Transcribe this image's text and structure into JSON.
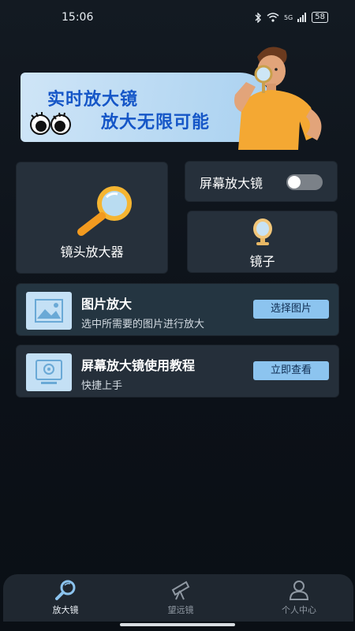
{
  "status_bar": {
    "time": "15:06",
    "bluetooth_icon": "bluetooth-icon",
    "wifi_icon": "wifi-icon",
    "signal_text": "5G",
    "battery": "58"
  },
  "banner": {
    "line1": "实时放大镜",
    "line2": "放大无限可能"
  },
  "cards": {
    "lens": {
      "label": "镜头放大器",
      "icon": "magnifier-icon"
    },
    "screen_magnifier": {
      "label": "屏幕放大镜",
      "toggle_on": false
    },
    "mirror": {
      "label": "镜子",
      "icon": "mirror-icon"
    }
  },
  "rows": {
    "picture": {
      "title": "图片放大",
      "subtitle": "选中所需要的图片进行放大",
      "button": "选择图片",
      "icon": "image-icon"
    },
    "tutorial": {
      "title": "屏幕放大镜使用教程",
      "subtitle": "快捷上手",
      "button": "立即查看",
      "icon": "screen-icon"
    }
  },
  "bottom_nav": {
    "items": [
      {
        "label": "放大镜",
        "icon": "magnifier-icon",
        "active": true
      },
      {
        "label": "望远镜",
        "icon": "telescope-icon",
        "active": false
      },
      {
        "label": "个人中心",
        "icon": "person-icon",
        "active": false
      }
    ]
  },
  "colors": {
    "background": "#0d131a",
    "card": "#26303b",
    "banner_text": "#1556c7",
    "button_bg": "#8cc4ef"
  }
}
